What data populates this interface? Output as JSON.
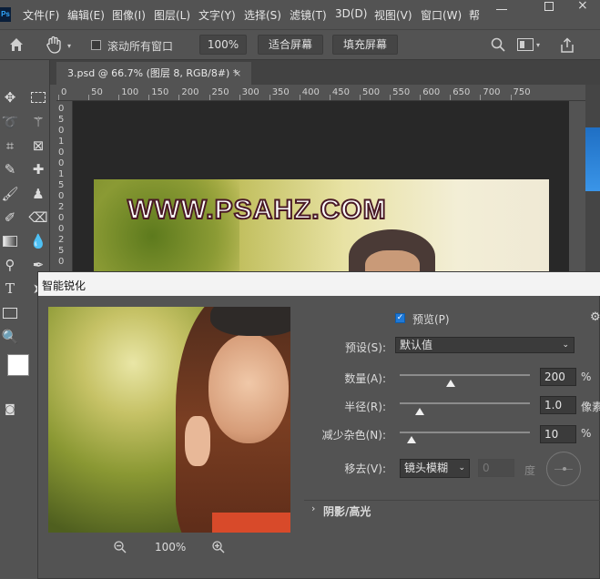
{
  "menubar": {
    "logo": "Ps",
    "items": [
      "文件(F)",
      "编辑(E)",
      "图像(I)",
      "图层(L)",
      "文字(Y)",
      "选择(S)",
      "滤镜(T)",
      "3D(D)",
      "视图(V)",
      "窗口(W)",
      "帮"
    ]
  },
  "options_bar": {
    "scroll_all_windows": "滚动所有窗口",
    "zoom_value": "100%",
    "fit_screen": "适合屏幕",
    "fill_screen": "填充屏幕"
  },
  "document_tab": {
    "title": "3.psd @ 66.7% (图层 8, RGB/8#) *",
    "close": "×"
  },
  "ruler": {
    "h_labels": [
      "0",
      "50",
      "100",
      "150",
      "200",
      "250",
      "300",
      "350",
      "400",
      "450",
      "500",
      "550",
      "600",
      "650",
      "700",
      "750"
    ],
    "v_labels": [
      "0",
      "5",
      "0",
      "1",
      "0",
      "0",
      "1",
      "5",
      "0",
      "2",
      "0",
      "0",
      "2",
      "5",
      "0"
    ]
  },
  "canvas": {
    "watermark": "WWW.PSAHZ.COM"
  },
  "dialog": {
    "title": "智能锐化",
    "preview_label": "预览(P)",
    "preview_checked": true,
    "preset_label": "预设(S):",
    "preset_value": "默认值",
    "amount_label": "数量(A):",
    "amount_value": "200",
    "amount_unit": "%",
    "amount_level": 0.28,
    "radius_label": "半径(R):",
    "radius_value": "1.0",
    "radius_unit": "像素",
    "radius_level": 0.15,
    "noise_label": "减少杂色(N):",
    "noise_value": "10",
    "noise_unit": "%",
    "noise_level": 0.08,
    "remove_label": "移去(V):",
    "remove_value": "镜头模糊",
    "angle_value": "0",
    "angle_unit": "度",
    "shadows_highlights": "阴影/高光",
    "zoom_level": "100%"
  },
  "colors": {
    "accent": "#1f6fc4",
    "panel": "#535353",
    "dark": "#282828"
  }
}
